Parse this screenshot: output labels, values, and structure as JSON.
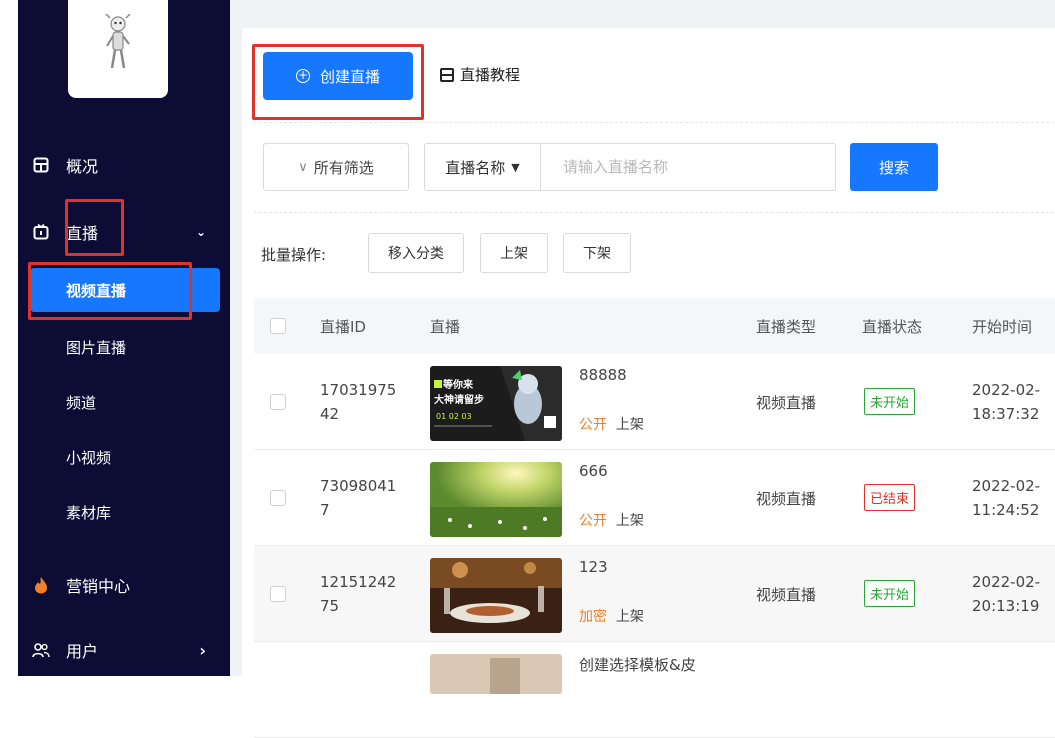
{
  "sidebar": {
    "items": [
      {
        "label": "概况",
        "icon": "dashboard-icon"
      },
      {
        "label": "直播",
        "icon": "tv-icon",
        "arrow": "⌄"
      },
      {
        "label": "营销中心",
        "icon": "fire-icon"
      },
      {
        "label": "用户",
        "icon": "users-icon",
        "arrow": "›"
      }
    ],
    "subitems": [
      "视频直播",
      "图片直播",
      "频道",
      "小视频",
      "素材库"
    ]
  },
  "toolbar": {
    "create_label": "创建直播",
    "tutorial_label": "直播教程"
  },
  "filters": {
    "all_filter_label": "所有筛选",
    "search_type_label": "直播名称",
    "search_placeholder": "请输入直播名称",
    "search_button": "搜索"
  },
  "batch": {
    "label": "批量操作:",
    "buttons": [
      "移入分类",
      "上架",
      "下架"
    ]
  },
  "table": {
    "headers": [
      "直播ID",
      "直播",
      "直播类型",
      "直播状态",
      "开始时间"
    ],
    "rows": [
      {
        "id_line1": "17031975",
        "id_line2": "42",
        "title": "88888",
        "visibility": "公开",
        "shelf": "上架",
        "type": "视频直播",
        "status": "未开始",
        "date": "2022-02-",
        "time": "18:37:32"
      },
      {
        "id_line1": "73098041",
        "id_line2": "7",
        "title": "666",
        "visibility": "公开",
        "shelf": "上架",
        "type": "视频直播",
        "status": "已结束",
        "date": "2022-02-",
        "time": "11:24:52"
      },
      {
        "id_line1": "12151242",
        "id_line2": "75",
        "title": "123",
        "visibility": "加密",
        "shelf": "上架",
        "type": "视频直播",
        "status": "未开始",
        "date": "2022-02-",
        "time": "20:13:19"
      },
      {
        "title": "创建选择模板&皮"
      }
    ]
  },
  "thumb_text": {
    "line1": "等你来",
    "line2": "大神请留步",
    "line3": "01 02 03"
  },
  "colors": {
    "primary": "#1677ff",
    "sidebar": "#0d0c35",
    "accent_orange": "#f0802b",
    "highlight_red": "#e0322d"
  }
}
